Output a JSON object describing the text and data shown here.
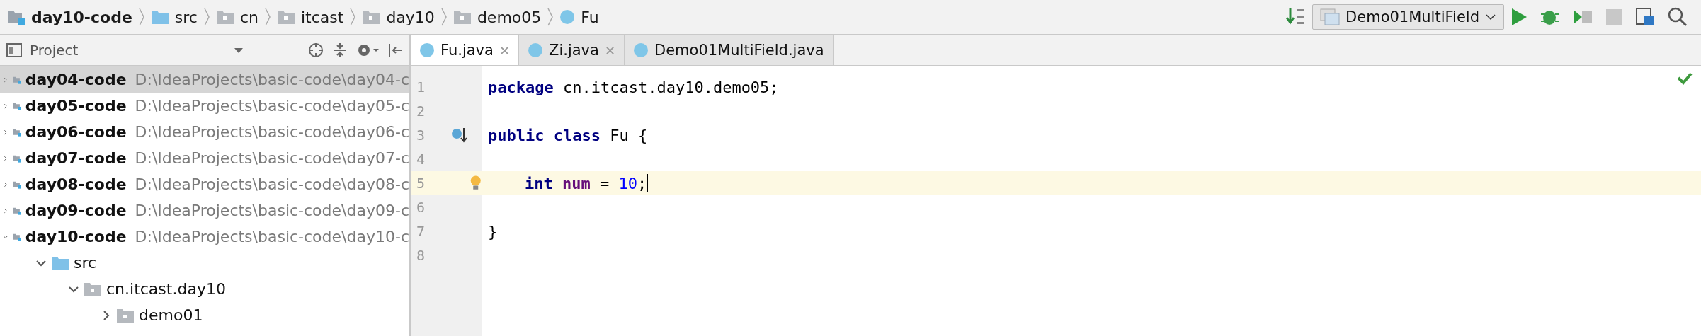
{
  "breadcrumbs": [
    {
      "kind": "module",
      "label": "day10-code"
    },
    {
      "kind": "source",
      "label": "src"
    },
    {
      "kind": "package",
      "label": "cn"
    },
    {
      "kind": "package",
      "label": "itcast"
    },
    {
      "kind": "package",
      "label": "day10"
    },
    {
      "kind": "package",
      "label": "demo05"
    },
    {
      "kind": "class",
      "label": "Fu"
    }
  ],
  "run_config": {
    "label": "Demo01MultiField"
  },
  "project_panel": {
    "title": "Project",
    "tree": [
      {
        "kind": "module",
        "label": "day04-code",
        "path": "D:\\IdeaProjects\\basic-code\\day04-c",
        "expanded": false,
        "selected": true
      },
      {
        "kind": "module",
        "label": "day05-code",
        "path": "D:\\IdeaProjects\\basic-code\\day05-c",
        "expanded": false,
        "selected": false
      },
      {
        "kind": "module",
        "label": "day06-code",
        "path": "D:\\IdeaProjects\\basic-code\\day06-c",
        "expanded": false,
        "selected": false
      },
      {
        "kind": "module",
        "label": "day07-code",
        "path": "D:\\IdeaProjects\\basic-code\\day07-c",
        "expanded": false,
        "selected": false
      },
      {
        "kind": "module",
        "label": "day08-code",
        "path": "D:\\IdeaProjects\\basic-code\\day08-c",
        "expanded": false,
        "selected": false
      },
      {
        "kind": "module",
        "label": "day09-code",
        "path": "D:\\IdeaProjects\\basic-code\\day09-c",
        "expanded": false,
        "selected": false
      },
      {
        "kind": "module",
        "label": "day10-code",
        "path": "D:\\IdeaProjects\\basic-code\\day10-c",
        "expanded": true,
        "selected": false,
        "children": [
          {
            "kind": "source",
            "label": "src",
            "expanded": true,
            "selected": false,
            "children": [
              {
                "kind": "package",
                "label": "cn.itcast.day10",
                "expanded": true,
                "selected": false,
                "children": [
                  {
                    "kind": "package",
                    "label": "demo01",
                    "expanded": false,
                    "selected": false
                  }
                ]
              }
            ]
          }
        ]
      }
    ]
  },
  "tabs": [
    {
      "label": "Fu.java",
      "selected": true,
      "close": "✕"
    },
    {
      "label": "Zi.java",
      "selected": false,
      "close": "✕"
    },
    {
      "label": "Demo01MultiField.java",
      "selected": false
    }
  ],
  "editor": {
    "lines": [
      {
        "number": "1",
        "current": false,
        "kind": "plain",
        "tokens": [
          {
            "kind": "keyword",
            "text": "package "
          },
          {
            "kind": "plain",
            "text": "cn.itcast.day10.demo05;"
          }
        ]
      },
      {
        "number": "2",
        "current": false,
        "kind": "plain"
      },
      {
        "number": "3",
        "current": false,
        "kind": "override",
        "tokens": [
          {
            "kind": "keyword",
            "text": "public "
          },
          {
            "kind": "keyword",
            "text": "class "
          },
          {
            "kind": "plain",
            "text": "Fu {"
          }
        ]
      },
      {
        "number": "4",
        "current": false,
        "kind": "plain"
      },
      {
        "number": "5",
        "current": true,
        "kind": "bulb",
        "indented": true,
        "tokens": [
          {
            "kind": "keyword",
            "text": "int "
          },
          {
            "kind": "field",
            "text": "num"
          },
          {
            "kind": "plain",
            "text": " = "
          },
          {
            "kind": "number",
            "text": "10"
          },
          {
            "kind": "plain",
            "text": ";"
          }
        ]
      },
      {
        "number": "6",
        "current": false,
        "kind": "plain"
      },
      {
        "number": "7",
        "current": false,
        "kind": "plain",
        "tokens": [
          {
            "kind": "plain",
            "text": "}"
          }
        ]
      },
      {
        "number": "8",
        "current": false,
        "kind": "plain"
      }
    ]
  }
}
